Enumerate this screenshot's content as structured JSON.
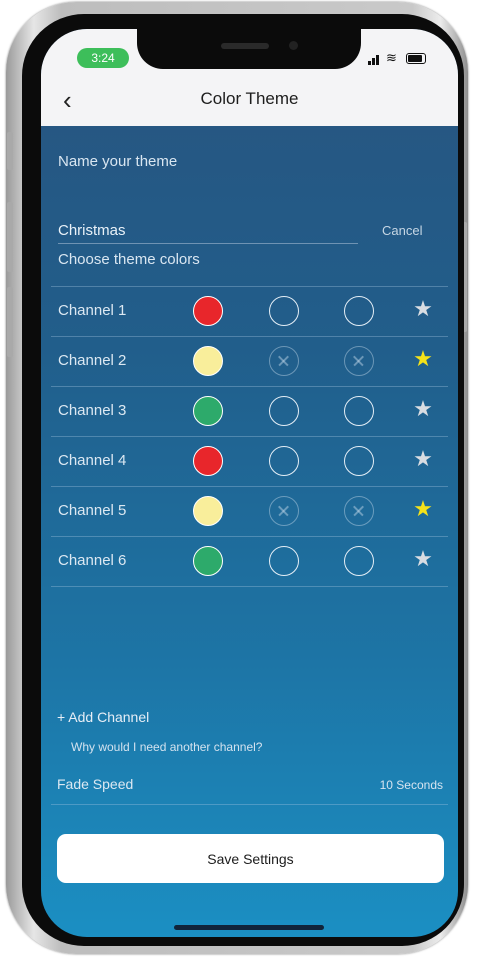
{
  "status_bar": {
    "time": "3:24"
  },
  "header": {
    "title": "Color Theme"
  },
  "name_section": {
    "label": "Name your theme",
    "value": "Christmas",
    "cancel_label": "Cancel"
  },
  "colors_section": {
    "label": "Choose theme colors"
  },
  "channels": [
    {
      "label": "Channel 1",
      "color": "#e8262b",
      "slots": [
        "empty",
        "empty"
      ],
      "star_color": "#d9dde2"
    },
    {
      "label": "Channel 2",
      "color": "#f9ee9b",
      "slots": [
        "disabled",
        "disabled"
      ],
      "star_color": "#f4e21a"
    },
    {
      "label": "Channel 3",
      "color": "#2daa6b",
      "slots": [
        "empty",
        "empty"
      ],
      "star_color": "#d9dde2"
    },
    {
      "label": "Channel 4",
      "color": "#e8262b",
      "slots": [
        "empty",
        "empty"
      ],
      "star_color": "#d9dde2"
    },
    {
      "label": "Channel 5",
      "color": "#f9ee9b",
      "slots": [
        "disabled",
        "disabled"
      ],
      "star_color": "#f4e21a"
    },
    {
      "label": "Channel 6",
      "color": "#2daa6b",
      "slots": [
        "empty",
        "empty"
      ],
      "star_color": "#d9dde2"
    }
  ],
  "add_channel_label": "+ Add Channel",
  "help_link": "Why would I need another channel?",
  "fade_speed": {
    "label": "Fade Speed",
    "value": "10 Seconds"
  },
  "save_button_label": "Save Settings",
  "icons": {
    "back": "chevron-left-icon",
    "star": "star-icon",
    "disabled_slot": "circle-x-icon",
    "signal": "signal-icon",
    "wifi": "wifi-icon",
    "battery": "battery-icon"
  },
  "colors": {
    "accent_green": "#3dbe5a",
    "star_highlight": "#f4e21a",
    "star_default": "#d9dde2",
    "background_top": "#28547f",
    "background_bottom": "#1b8fc3"
  }
}
